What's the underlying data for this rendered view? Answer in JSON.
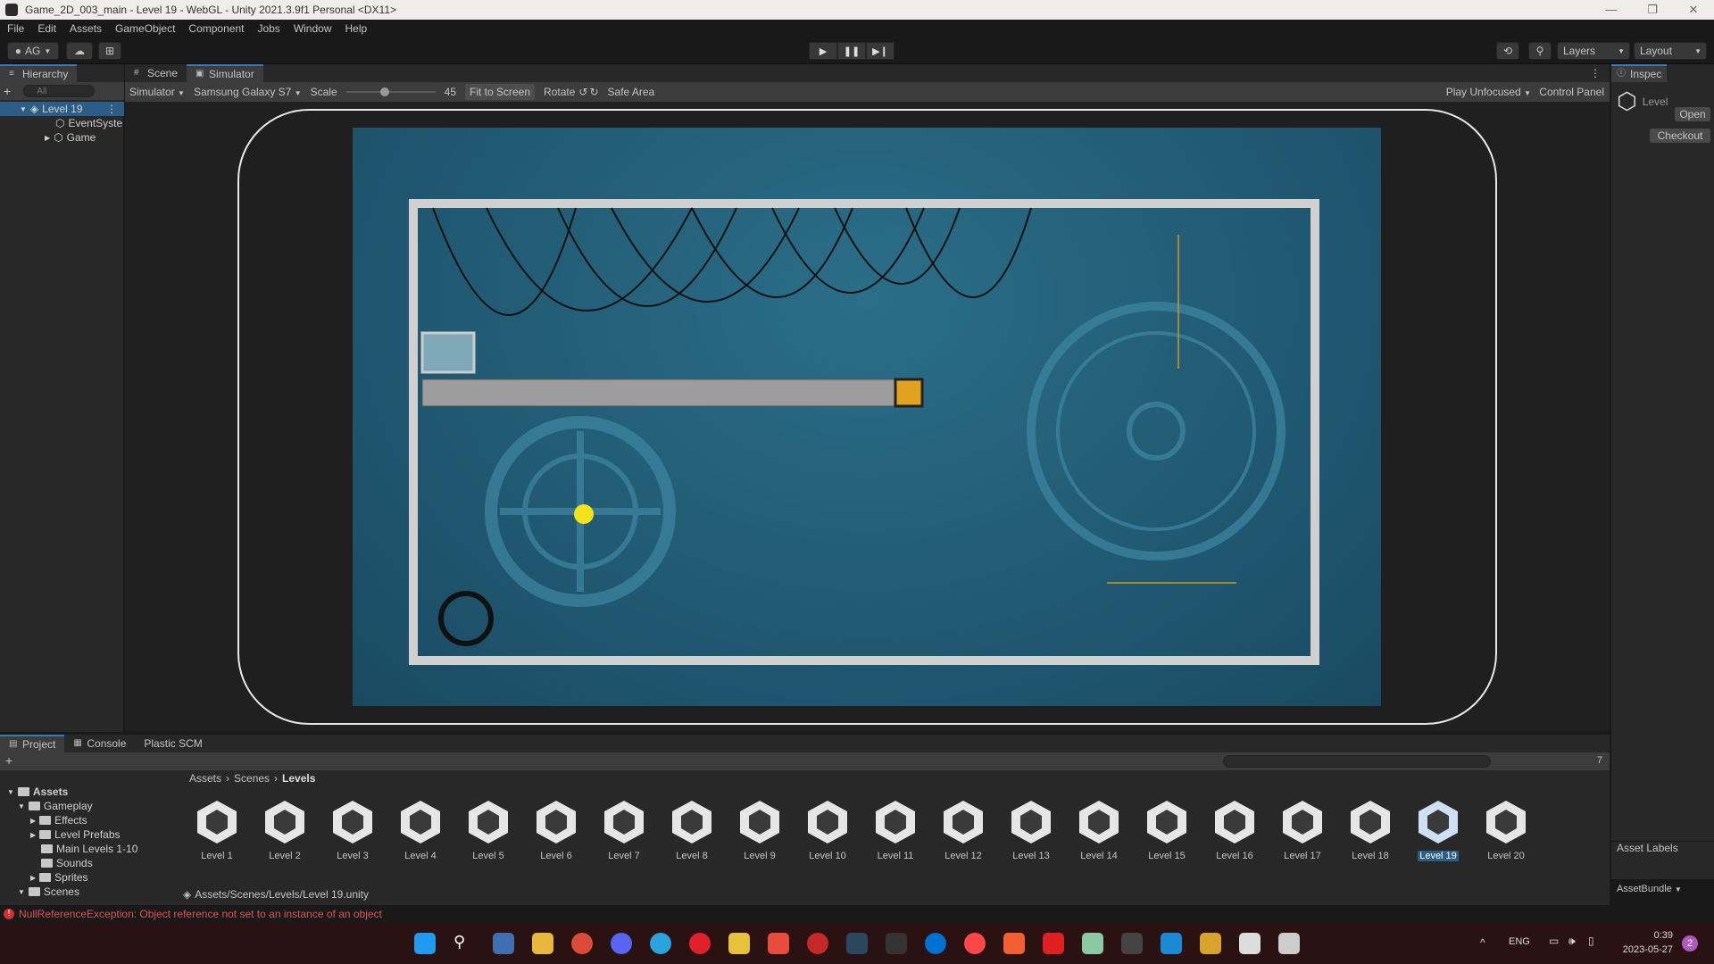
{
  "window": {
    "title": "Game_2D_003_main - Level 19 - WebGL - Unity 2021.3.9f1 Personal <DX11>"
  },
  "menu": [
    "File",
    "Edit",
    "Assets",
    "GameObject",
    "Component",
    "Jobs",
    "Window",
    "Help"
  ],
  "toolbar": {
    "account": "AG",
    "layers": "Layers",
    "layout": "Layout"
  },
  "hierarchy": {
    "tab": "Hierarchy",
    "search_placeholder": "All",
    "scene": "Level 19",
    "items": [
      "EventSyste",
      "Game"
    ]
  },
  "scene_tabs": [
    "Scene",
    "Simulator"
  ],
  "simulator": {
    "mode": "Simulator",
    "device": "Samsung Galaxy S7",
    "scale_label": "Scale",
    "scale_value": "45",
    "fit_to_screen": "Fit to Screen",
    "rotate": "Rotate",
    "safe_area": "Safe Area",
    "play_unfocused": "Play Unfocused",
    "control_panel": "Control Panel"
  },
  "inspector": {
    "tab": "Inspec",
    "object": "Level",
    "open": "Open",
    "checkout": "Checkout",
    "asset_labels": "Asset Labels",
    "asset_bundle": "AssetBundle"
  },
  "project": {
    "tabs": [
      "Project",
      "Console",
      "Plastic SCM"
    ],
    "breadcrumb": [
      "Assets",
      "Scenes",
      "Levels"
    ],
    "tree": [
      {
        "label": "Assets",
        "depth": 0
      },
      {
        "label": "Gameplay",
        "depth": 1
      },
      {
        "label": "Effects",
        "depth": 2
      },
      {
        "label": "Level Prefabs",
        "depth": 2
      },
      {
        "label": "Main Levels 1-10",
        "depth": 2
      },
      {
        "label": "Sounds",
        "depth": 2
      },
      {
        "label": "Sprites",
        "depth": 2
      },
      {
        "label": "Scenes",
        "depth": 1
      }
    ],
    "assets": [
      "Level 1",
      "Level 2",
      "Level 3",
      "Level 4",
      "Level 5",
      "Level 6",
      "Level 7",
      "Level 8",
      "Level 9",
      "Level 10",
      "Level 11",
      "Level 12",
      "Level 13",
      "Level 14",
      "Level 15",
      "Level 16",
      "Level 17",
      "Level 18",
      "Level 19",
      "Level 20"
    ],
    "selected_asset": "Level 19",
    "path": "Assets/Scenes/Levels/Level 19.unity",
    "hidden_count": "7"
  },
  "status": {
    "error": "NullReferenceException: Object reference not set to an instance of an object"
  },
  "taskbar": {
    "lang": "ENG",
    "time": "0:39",
    "date": "2023-05-27",
    "notifications": "2"
  }
}
